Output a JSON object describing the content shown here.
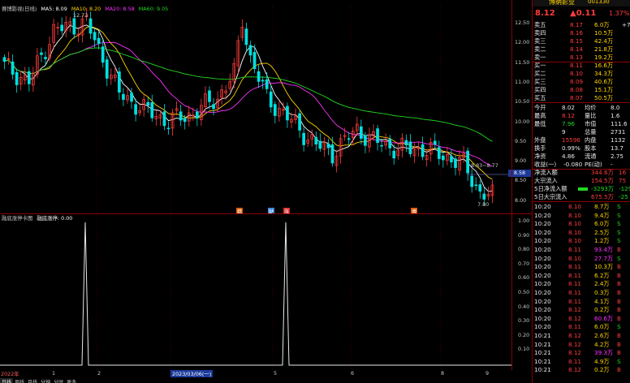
{
  "ma_legend": {
    "title": "赛博影视(日线)",
    "ma5": "MA5: 8.09",
    "ma10": "MA10: 8.20",
    "ma20": "MA20: 8.58",
    "ma60": "MA60: 9.05",
    "colors": {
      "ma5": "#ffffff",
      "ma10": "#ffd400",
      "ma20": "#ff30ff",
      "ma60": "#22d822"
    }
  },
  "chart_labels": {
    "high_mark": "12.73",
    "low_mark": "7.80",
    "mid_mark": "8.83~8.77",
    "cross_price": "8.58",
    "event_1": "精",
    "event_2": "财",
    "event_3": "涨",
    "event_4": "博"
  },
  "price_axis": [
    "12.50",
    "12.00",
    "11.50",
    "11.00",
    "10.50",
    "10.00",
    "9.50",
    "9.00",
    "8.50",
    "8.00"
  ],
  "indicator": {
    "legend_a": "融底涨停卡图",
    "legend_b": "融底涨停: 0.00",
    "axis": [
      "1.00",
      "0.90",
      "0.80",
      "0.70",
      "0.60",
      "0.50",
      "0.40",
      "0.30",
      "0.20",
      "0.10"
    ]
  },
  "date_axis": {
    "year": "2022年",
    "m1": "1",
    "m2": "2",
    "selected_date": "2023/03/06(一)",
    "m5": "5",
    "m6": "6",
    "m8": "8",
    "m9": "9"
  },
  "bottom_tabs": [
    "日线",
    "周线",
    "月线",
    "分钟",
    "分时",
    "更多"
  ],
  "right_panel": {
    "stock_name": "博纳影业",
    "stock_code": "001330",
    "price": "8.12",
    "change": "▲0.11",
    "change_pct": "1.37%",
    "sell_book": [
      {
        "label": "卖五",
        "price": "8.17",
        "vol": "6.0万",
        "chg": "+7"
      },
      {
        "label": "卖四",
        "price": "8.16",
        "vol": "10.5万",
        "chg": ""
      },
      {
        "label": "卖三",
        "price": "8.15",
        "vol": "42.4万",
        "chg": ""
      },
      {
        "label": "卖二",
        "price": "8.14",
        "vol": "21.8万",
        "chg": ""
      },
      {
        "label": "卖一",
        "price": "8.13",
        "vol": "19.2万",
        "chg": ""
      }
    ],
    "buy_book": [
      {
        "label": "买一",
        "price": "8.11",
        "vol": "16.6万",
        "chg": ""
      },
      {
        "label": "买二",
        "price": "8.10",
        "vol": "34.3万",
        "chg": ""
      },
      {
        "label": "买三",
        "price": "8.09",
        "vol": "40.6万",
        "chg": ""
      },
      {
        "label": "买四",
        "price": "8.08",
        "vol": "15.1万",
        "chg": ""
      },
      {
        "label": "买五",
        "price": "8.07",
        "vol": "50.5万",
        "chg": ""
      }
    ],
    "quote": [
      {
        "k1": "今开",
        "v1": "8.02",
        "k2": "均价",
        "v2": "8.0"
      },
      {
        "k1": "最高",
        "v1": "8.12",
        "k2": "量比",
        "v2": "1.6"
      },
      {
        "k1": "最低",
        "v1": "7.96",
        "k2": "市值",
        "v2": "111.6"
      },
      {
        "k1": "",
        "v1": "9",
        "k2": "总量",
        "v2": "2731"
      },
      {
        "k1": "外盘",
        "v1": "15596",
        "k2": "内盘",
        "v2": "1132"
      },
      {
        "k1": "换手",
        "v1": "0.99%",
        "k2": "股本",
        "v2": "13.7"
      },
      {
        "k1": "净资",
        "v1": "4.86",
        "k2": "流通",
        "v2": "2.75"
      },
      {
        "k1": "收益(一)",
        "v1": "-0.080",
        "k2": "PE(动)",
        "v2": "-"
      }
    ],
    "flows": [
      {
        "label": "净流入额",
        "val": "344.6万",
        "extra": "16"
      },
      {
        "label": "大宗流入",
        "val": "154.5万",
        "extra": "75"
      },
      {
        "label": "5日净流入额",
        "val": "-3293万",
        "extra": "-129"
      },
      {
        "label": "5日大宗流入",
        "val": "675.5万",
        "extra": "-25"
      }
    ],
    "ticks": [
      {
        "t": "10:20",
        "p": "8.10",
        "v": "8.7万",
        "s": "S"
      },
      {
        "t": "10:20",
        "p": "8.10",
        "v": "9.4万",
        "s": "S"
      },
      {
        "t": "10:20",
        "p": "8.10",
        "v": "6.0万",
        "s": "S"
      },
      {
        "t": "10:20",
        "p": "8.10",
        "v": "2.5万",
        "s": "S"
      },
      {
        "t": "10:20",
        "p": "8.10",
        "v": "1.2万",
        "s": "S"
      },
      {
        "t": "10:20",
        "p": "8.11",
        "v": "93.4万",
        "s": "B"
      },
      {
        "t": "10:20",
        "p": "8.10",
        "v": "27.7万",
        "s": "S"
      },
      {
        "t": "10:20",
        "p": "8.11",
        "v": "10.3万",
        "s": "B"
      },
      {
        "t": "10:20",
        "p": "8.11",
        "v": "6.2万",
        "s": "B"
      },
      {
        "t": "10:20",
        "p": "8.11",
        "v": "2.4万",
        "s": "B"
      },
      {
        "t": "10:20",
        "p": "8.11",
        "v": "0.3万",
        "s": "B"
      },
      {
        "t": "10:20",
        "p": "8.11",
        "v": "4.1万",
        "s": "B"
      },
      {
        "t": "10:20",
        "p": "8.12",
        "v": "0.2万",
        "s": "B"
      },
      {
        "t": "10:20",
        "p": "8.12",
        "v": "60.6万",
        "s": "B"
      },
      {
        "t": "10:20",
        "p": "8.11",
        "v": "6.0万",
        "s": "S"
      },
      {
        "t": "10:21",
        "p": "8.12",
        "v": "2.6万",
        "s": "B"
      },
      {
        "t": "10:21",
        "p": "8.12",
        "v": "4.2万",
        "s": "B"
      },
      {
        "t": "10:21",
        "p": "8.12",
        "v": "39.3万",
        "s": "B"
      },
      {
        "t": "10:21",
        "p": "8.11",
        "v": "4.9万",
        "s": "S"
      },
      {
        "t": "10:21",
        "p": "8.12",
        "v": "0.2万",
        "s": "B"
      }
    ]
  },
  "colors": {
    "up": "#ff3c3c",
    "down": "#00e0e0",
    "grid": "#8b0000"
  }
}
